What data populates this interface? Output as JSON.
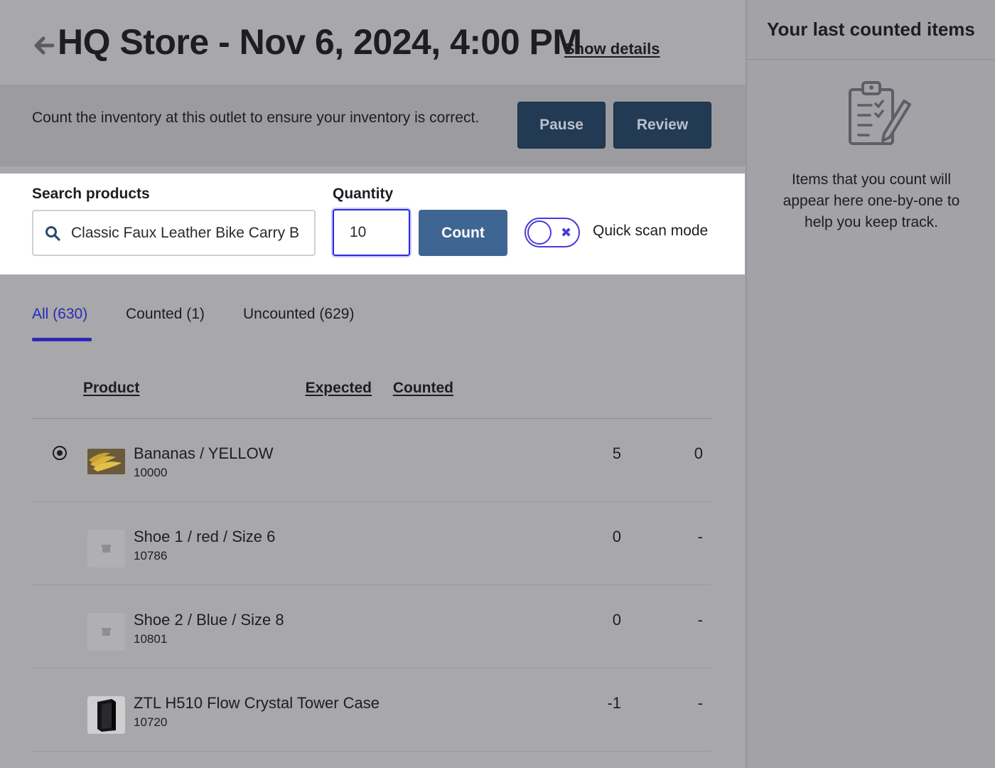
{
  "header": {
    "title": "HQ Store - Nov 6, 2024, 4:00 PM",
    "show_details": "Show details"
  },
  "info": {
    "text": "Count the inventory at this outlet to ensure your inventory is correct.",
    "pause_label": "Pause",
    "review_label": "Review"
  },
  "count_panel": {
    "search_label": "Search products",
    "search_value": "Classic Faux Leather Bike Carry Bag",
    "quantity_label": "Quantity",
    "quantity_value": "10",
    "count_label": "Count",
    "toggle_state": "off",
    "quick_scan_label": "Quick scan mode"
  },
  "tabs": [
    {
      "label": "All (630)",
      "active": true
    },
    {
      "label": "Counted (1)",
      "active": false
    },
    {
      "label": "Uncounted (629)",
      "active": false
    }
  ],
  "table": {
    "columns": {
      "product": "Product",
      "expected": "Expected",
      "counted": "Counted"
    },
    "rows": [
      {
        "name": "Bananas / YELLOW",
        "sku": "10000",
        "expected": "5",
        "counted": "0",
        "thumb": "bananas-photo",
        "selected": true
      },
      {
        "name": "Shoe 1 / red / Size 6",
        "sku": "10786",
        "expected": "0",
        "counted": "-",
        "thumb": "placeholder-icon",
        "selected": false
      },
      {
        "name": "Shoe 2 / Blue / Size 8",
        "sku": "10801",
        "expected": "0",
        "counted": "-",
        "thumb": "placeholder-icon",
        "selected": false
      },
      {
        "name": "ZTL H510 Flow Crystal Tower Case",
        "sku": "10720",
        "expected": "-1",
        "counted": "-",
        "thumb": "tower-case-photo",
        "selected": false
      }
    ]
  },
  "sidebar": {
    "title": "Your last counted items",
    "empty_text": "Items that you count will appear here one-by-one to help you keep track.",
    "icon": "clipboard-checklist-icon"
  },
  "colors": {
    "primary_button": "#3f6592",
    "dark_button": "#223a54",
    "accent": "#2a2ab6",
    "toggle": "#4a3bd6"
  }
}
